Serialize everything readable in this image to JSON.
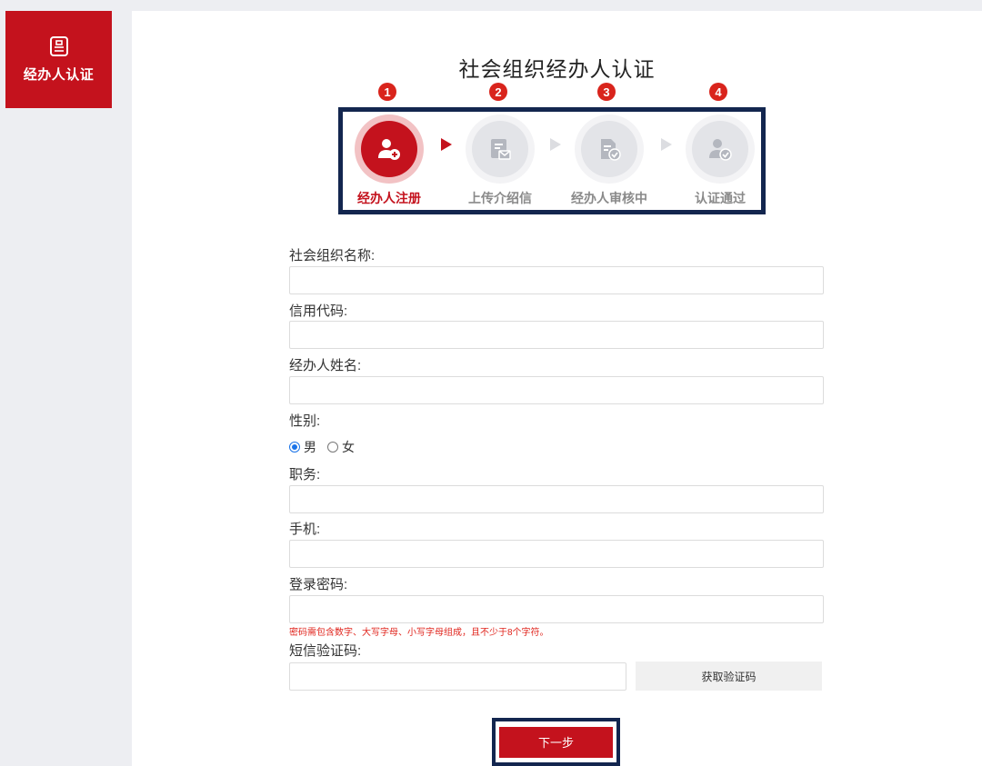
{
  "sidebar": {
    "item_label": "经办人认证",
    "active_color": "#c4121d"
  },
  "page": {
    "title": "社会组织经办人认证"
  },
  "steps": [
    {
      "num": "1",
      "label": "经办人注册",
      "state": "active"
    },
    {
      "num": "2",
      "label": "上传介绍信",
      "state": "inactive"
    },
    {
      "num": "3",
      "label": "经办人审核中",
      "state": "inactive"
    },
    {
      "num": "4",
      "label": "认证通过",
      "state": "inactive"
    }
  ],
  "form": {
    "org_name_label": "社会组织名称:",
    "credit_code_label": "信用代码:",
    "agent_name_label": "经办人姓名:",
    "gender_label": "性别:",
    "gender_options": [
      "男",
      "女"
    ],
    "gender_selected": "男",
    "position_label": "职务:",
    "phone_label": "手机:",
    "password_label": "登录密码:",
    "password_hint": "密码需包含数字、大写字母、小写字母组成，且不少于8个字符。",
    "sms_label": "短信验证码:",
    "sms_button": "获取验证码",
    "next_button": "下一步"
  },
  "colors": {
    "brand_red": "#c4121d",
    "highlight_border": "#13264f",
    "hint_red": "#e0241c"
  }
}
